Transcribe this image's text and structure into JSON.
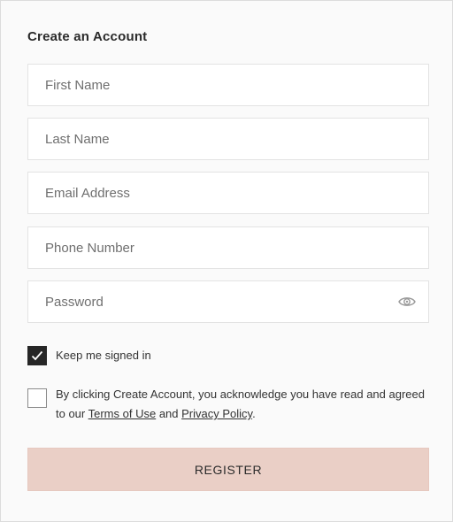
{
  "form": {
    "title": "Create an Account",
    "fields": {
      "first_name": {
        "placeholder": "First Name",
        "value": ""
      },
      "last_name": {
        "placeholder": "Last Name",
        "value": ""
      },
      "email": {
        "placeholder": "Email Address",
        "value": ""
      },
      "phone": {
        "placeholder": "Phone Number",
        "value": ""
      },
      "password": {
        "placeholder": "Password",
        "value": "",
        "toggle_icon": "eye-icon"
      }
    },
    "keep_signed_in": {
      "label": "Keep me signed in",
      "checked": true
    },
    "consent": {
      "checked": false,
      "text_before": "By clicking Create Account, you acknowledge you have read and agreed to our ",
      "terms_link": "Terms of Use",
      "text_between": " and ",
      "privacy_link": "Privacy Policy",
      "text_after": "."
    },
    "register_label": "REGISTER"
  },
  "colors": {
    "register_bg": "#eacfc6",
    "checkbox_checked": "#262626",
    "field_border": "#e3e3e3"
  }
}
